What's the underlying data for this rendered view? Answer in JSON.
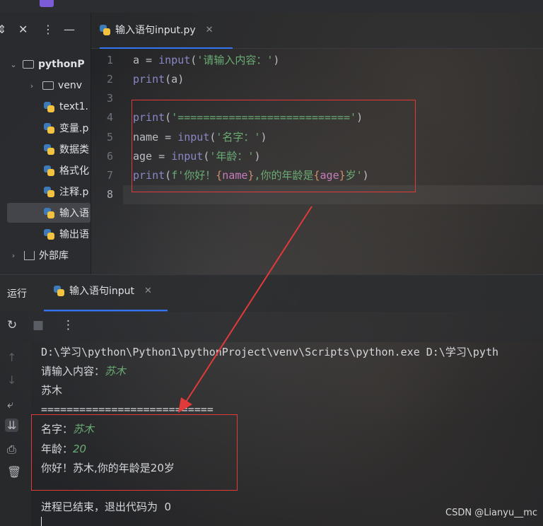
{
  "project": {
    "root_name": "pythonP",
    "items": [
      {
        "label": "venv",
        "type": "folder"
      },
      {
        "label": "text1.",
        "type": "py"
      },
      {
        "label": "变量.p",
        "type": "py"
      },
      {
        "label": "数据类",
        "type": "py"
      },
      {
        "label": "格式化",
        "type": "py"
      },
      {
        "label": "注释.p",
        "type": "py"
      },
      {
        "label": "输入语",
        "type": "py",
        "selected": true
      },
      {
        "label": "输出语",
        "type": "py"
      }
    ],
    "external_libs": "外部库"
  },
  "editor": {
    "tab_label": "输入语句input.py",
    "line_numbers": [
      "1",
      "2",
      "3",
      "4",
      "5",
      "6",
      "7",
      "8"
    ],
    "lines": [
      "a = input('请输入内容：')",
      "print(a)",
      "",
      "print('===========================')",
      "name = input('名字：')",
      "age = input('年龄：')",
      "print(f'你好！{name},你的年龄是{age}岁')",
      ""
    ],
    "tokens": {
      "l1_a": "a = ",
      "l1_fn": "input",
      "l1_p1": "(",
      "l1_str": "'请输入内容：'",
      "l1_p2": ")",
      "l2_kw": "print",
      "l2_rest": "(a)",
      "l4_kw": "print",
      "l4_p1": "(",
      "l4_str": "'==========================='",
      "l4_p2": ")",
      "l5_a": "name = ",
      "l5_fn": "input",
      "l5_p1": "(",
      "l5_str": "'名字：'",
      "l5_p2": ")",
      "l6_a": "age = ",
      "l6_fn": "input",
      "l6_p1": "(",
      "l6_str": "'年龄：'",
      "l6_p2": ")",
      "l7_kw": "print",
      "l7_p1": "(",
      "l7_s1": "f'你好！",
      "l7_b1": "{",
      "l7_v1": "name",
      "l7_b2": "}",
      "l7_s2": ",你的年龄是",
      "l7_b3": "{",
      "l7_v2": "age",
      "l7_b4": "}",
      "l7_s3": "岁'",
      "l7_p2": ")"
    }
  },
  "run": {
    "panel_label": "运行",
    "tab_label": "输入语句input",
    "command": "D:\\学习\\python\\Python1\\pythonProject\\venv\\Scripts\\python.exe D:\\学习\\pyth",
    "prompt1": "请输入内容：",
    "input1": "苏木",
    "echo": "苏木",
    "separator": "===========================",
    "prompt2": "名字：",
    "input2": "苏木",
    "prompt3": "年龄：",
    "input3": "20",
    "greeting": "你好！苏木,你的年龄是20岁",
    "exit_msg": "进程已结束，退出代码为  0"
  },
  "watermark": "CSDN @Lianyu__mc",
  "colors": {
    "accent": "#3574f0",
    "annotation": "#e03a3a",
    "string": "#6aab73",
    "keyword": "#56a8f5"
  }
}
